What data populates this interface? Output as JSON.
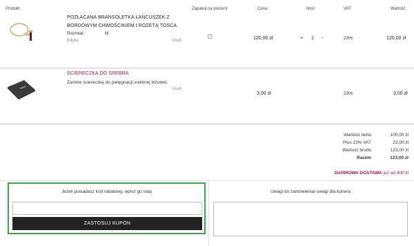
{
  "table_headers": {
    "product": "Produkt",
    "gift": "Zapakuj na prezent",
    "price": "Cena",
    "qty": "Ilość",
    "vat": "VAT",
    "value": "Wartość"
  },
  "items": [
    {
      "name_line1": "POZŁACANA BRANSOLETKA ŁAŃCUSZEK Z",
      "name_line2": "BORDOWYM CHWOŚCIKIEM I ROZETĄ TOSCA",
      "size_label": "Rozmiar:",
      "size_value": "M",
      "edit_label": "Edytuj",
      "remove_label": "Usuń",
      "price": "120,00 zł",
      "qty_minus": "-",
      "qty_value": "1",
      "qty_plus": "+",
      "vat": "23%",
      "value": "120,00 zł"
    },
    {
      "name_line1": "ŚCIERECZKA DO SREBRA",
      "description": "Zamów ściereczkę do pielęgnacji srebrnej biżuterii.",
      "remove_label": "Usuń",
      "price": "3,00 zł",
      "vat": "23%",
      "value": "3,00 zł"
    }
  ],
  "summary": {
    "net_label": "Wartość netto",
    "net_value": "100,00 zł",
    "vat_label": "Plus 23% VAT",
    "vat_value": "23,00 zł",
    "gross_label": "Wartość brutto",
    "gross_value": "123,00 zł",
    "total_label": "Razem",
    "total_value": "123,00 zł",
    "free_delivery_strong": "DARMOWA DOSTAWA",
    "free_delivery_rest": " już od 400 zł"
  },
  "coupon": {
    "label": "Jeżeli posiadasz kod rabatowy, wpisz go tutaj",
    "input_value": "",
    "button_label": "ZASTOSUJ KUPON"
  },
  "notes": {
    "label": "Uwagi do zamówienia/ uwagi dla kuriera",
    "value": ""
  },
  "colors": {
    "accent": "#9b1b48",
    "coupon_highlight": "#3aa648",
    "button_bg": "#222222"
  }
}
